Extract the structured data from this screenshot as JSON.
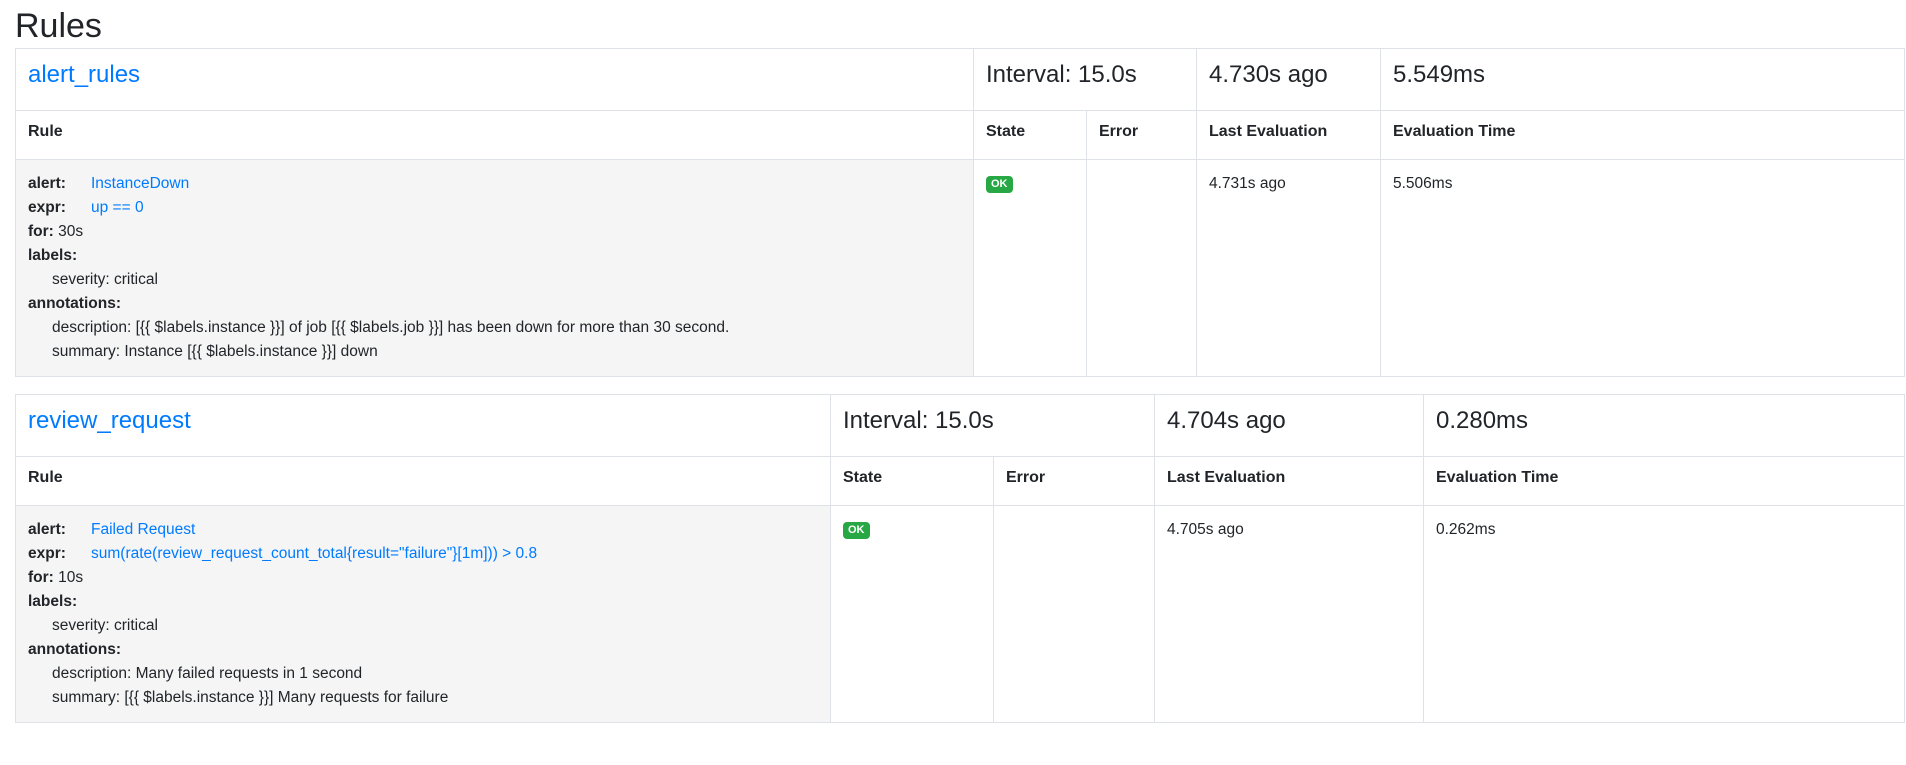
{
  "page": {
    "title": "Rules"
  },
  "groups": [
    {
      "name": "alert_rules",
      "interval": "Interval: 15.0s",
      "last_evaluation": "4.730s ago",
      "evaluation_time": "5.549ms",
      "headers": {
        "rule": "Rule",
        "state": "State",
        "error": "Error",
        "last_evaluation": "Last Evaluation",
        "evaluation_time": "Evaluation Time"
      },
      "rule": {
        "alert_key": "alert:",
        "alert_value": "InstanceDown",
        "expr_key": "expr:",
        "expr_value": "up == 0",
        "for_key": "for:",
        "for_value": "30s",
        "labels_key": "labels:",
        "label_1": "severity: critical",
        "annotations_key": "annotations:",
        "annotation_1": "description: [{{ $labels.instance }}] of job [{{ $labels.job }}] has been down for more than 30 second.",
        "annotation_2": "summary: Instance [{{ $labels.instance }}] down",
        "state": "OK",
        "error": "",
        "last_evaluation": "4.731s ago",
        "evaluation_time": "5.506ms"
      }
    },
    {
      "name": "review_request",
      "interval": "Interval: 15.0s",
      "last_evaluation": "4.704s ago",
      "evaluation_time": "0.280ms",
      "headers": {
        "rule": "Rule",
        "state": "State",
        "error": "Error",
        "last_evaluation": "Last Evaluation",
        "evaluation_time": "Evaluation Time"
      },
      "rule": {
        "alert_key": "alert:",
        "alert_value": "Failed Request",
        "expr_key": "expr:",
        "expr_value": "sum(rate(review_request_count_total{result=\"failure\"}[1m])) > 0.8",
        "for_key": "for:",
        "for_value": "10s",
        "labels_key": "labels:",
        "label_1": "severity: critical",
        "annotations_key": "annotations:",
        "annotation_1": "description: Many failed requests in 1 second",
        "annotation_2": "summary: [{{ $labels.instance }}] Many requests for failure",
        "state": "OK",
        "error": "",
        "last_evaluation": "4.705s ago",
        "evaluation_time": "0.262ms"
      }
    }
  ],
  "colors": {
    "link": "#007bff",
    "ok_badge": "#28a745",
    "rule_cell_bg": "#f5f5f5",
    "border": "#dee2e6"
  }
}
